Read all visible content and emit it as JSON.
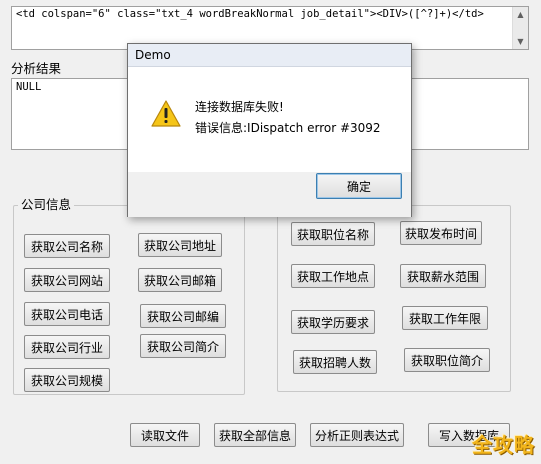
{
  "regex_box": {
    "value": "<td colspan=\"6\" class=\"txt_4 wordBreakNormal job_detail\"><DIV>([^?]+)</td>"
  },
  "result": {
    "label": "分析结果",
    "value": "NULL"
  },
  "company_group": {
    "title": "公司信息",
    "buttons": [
      "获取公司名称",
      "获取公司地址",
      "获取公司网站",
      "获取公司邮箱",
      "获取公司电话",
      "获取公司邮编",
      "获取公司行业",
      "获取公司简介",
      "获取公司规模"
    ]
  },
  "job_group": {
    "buttons": [
      "获取职位名称",
      "获取发布时间",
      "获取工作地点",
      "获取薪水范围",
      "获取学历要求",
      "获取工作年限",
      "获取招聘人数",
      "获取职位简介"
    ]
  },
  "bottom_buttons": [
    "读取文件",
    "获取全部信息",
    "分析正则表达式",
    "写入数据库"
  ],
  "dialog": {
    "title": "Demo",
    "message_line1": "连接数据库失败!",
    "message_line2": "错误信息:IDispatch error #3092",
    "ok_label": "确定",
    "icon": "warning-icon"
  },
  "watermark": "全攻略",
  "scroll_arrows": {
    "up": "▲",
    "down": "▼"
  }
}
